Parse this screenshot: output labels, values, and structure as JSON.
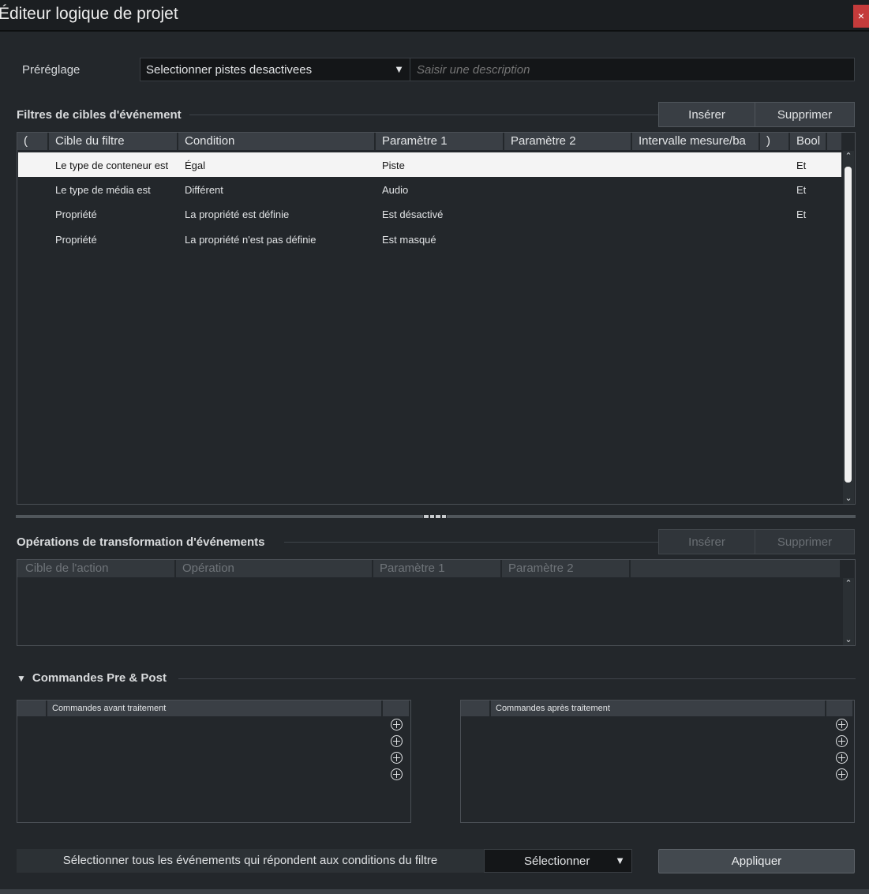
{
  "window": {
    "title": "Éditeur logique de projet",
    "close_glyph": "×"
  },
  "preset": {
    "label": "Préréglage",
    "value": "Selectionner pistes desactivees",
    "arrow": "▼",
    "description_placeholder": "Saisir une description"
  },
  "filters": {
    "title": "Filtres de cibles d'événement",
    "insert_label": "Insérer",
    "delete_label": "Supprimer",
    "columns": [
      "(",
      "Cible du filtre",
      "Condition",
      "Paramètre 1",
      "Paramètre 2",
      "Intervalle mesure/ba",
      ")",
      "Bool"
    ],
    "rows": [
      {
        "target": "Le type de conteneur est",
        "condition": "Égal",
        "param1": "Piste",
        "param2": "",
        "bool": "Et",
        "selected": true
      },
      {
        "target": "Le type de média est",
        "condition": "Différent",
        "param1": "Audio",
        "param2": "",
        "bool": "Et",
        "selected": false
      },
      {
        "target": "Propriété",
        "condition": "La propriété est définie",
        "param1": "Est désactivé",
        "param2": "",
        "bool": "Et",
        "selected": false
      },
      {
        "target": "Propriété",
        "condition": "La propriété n'est pas définie",
        "param1": "Est masqué",
        "param2": "",
        "bool": "",
        "selected": false
      }
    ]
  },
  "operations": {
    "title": "Opérations de transformation d'événements",
    "insert_label": "Insérer",
    "delete_label": "Supprimer",
    "columns": [
      "Cible de l'action",
      "Opération",
      "Paramètre 1",
      "Paramètre 2"
    ]
  },
  "commands": {
    "title": "Commandes Pre & Post",
    "toggle_glyph": "▼",
    "pre_header": "Commandes avant traitement",
    "post_header": "Commandes après traitement"
  },
  "footer": {
    "description": "Sélectionner tous les événements qui répondent aux conditions du filtre",
    "action_value": "Sélectionner",
    "arrow": "▼",
    "apply_label": "Appliquer"
  },
  "scroll_glyphs": {
    "up": "⌃",
    "down": "⌄"
  }
}
